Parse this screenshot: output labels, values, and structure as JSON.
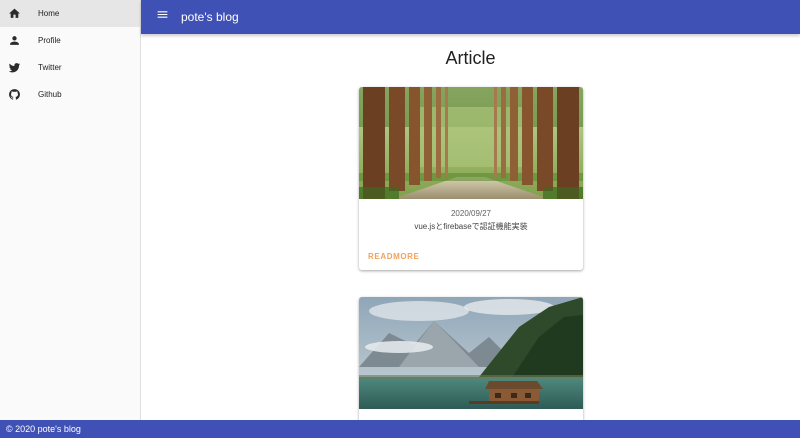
{
  "sidebar": {
    "items": [
      {
        "label": "Home",
        "icon": "home-icon",
        "active": true
      },
      {
        "label": "Profile",
        "icon": "account-icon",
        "active": false
      },
      {
        "label": "Twitter",
        "icon": "twitter-icon",
        "active": false
      },
      {
        "label": "Github",
        "icon": "github-icon",
        "active": false
      }
    ]
  },
  "appbar": {
    "title": "pote's blog",
    "menu_icon": "menu-icon",
    "color": "#3f51b5"
  },
  "main": {
    "title": "Article",
    "cards": [
      {
        "image": "forest-road-photo",
        "date": "2020/09/27",
        "text": "vue.jsとfirebaseで認証機能実装",
        "action": "READMORE"
      },
      {
        "image": "mountain-lake-cabin-photo"
      }
    ]
  },
  "footer": {
    "text": "© 2020 pote's blog"
  },
  "colors": {
    "primary": "#3f51b5",
    "accent": "#f0a25c",
    "sidebar_active": "#e6e6e6"
  }
}
